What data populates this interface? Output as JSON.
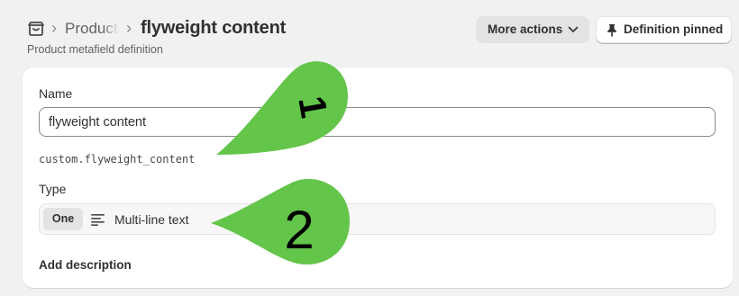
{
  "header": {
    "breadcrumb_link": "Products",
    "title": "flyweight content",
    "subtitle": "Product metafield definition",
    "more_actions_label": "More actions",
    "pinned_label": "Definition pinned"
  },
  "form": {
    "name_label": "Name",
    "name_value": "flyweight content",
    "namespace_key": "custom.flyweight_content",
    "type_label": "Type",
    "type_count": "One",
    "type_value": "Multi-line text",
    "type_icon": "multi-line-text-icon",
    "add_description_label": "Add description"
  },
  "annotations": {
    "marker_1_label": "1",
    "marker_2_label": "2",
    "marker_color": "#63c54a"
  },
  "colors": {
    "page_bg": "#f1f1f1",
    "card_bg": "#ffffff",
    "text": "#303030",
    "muted": "#616161"
  }
}
